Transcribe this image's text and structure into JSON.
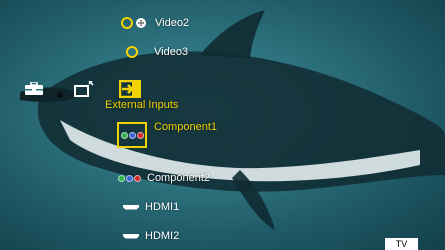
{
  "menu": {
    "active_category": "External Inputs",
    "categories": [
      {
        "name": "settings",
        "icon": "toolbox-icon"
      },
      {
        "name": "tv-source",
        "icon": "tv-screen-icon"
      },
      {
        "name": "external-inputs",
        "icon": "input-arrow-icon"
      }
    ]
  },
  "inputs": {
    "video2": "Video2",
    "video3": "Video3",
    "component1": "Component1",
    "component2": "Component2",
    "hdmi1": "HDMI1",
    "hdmi2": "HDMI2"
  },
  "badge": "TV",
  "colors": {
    "accent": "#f2d200",
    "component_green": "#2fb34a",
    "component_blue": "#3d63d6",
    "component_red": "#d12a2a"
  }
}
